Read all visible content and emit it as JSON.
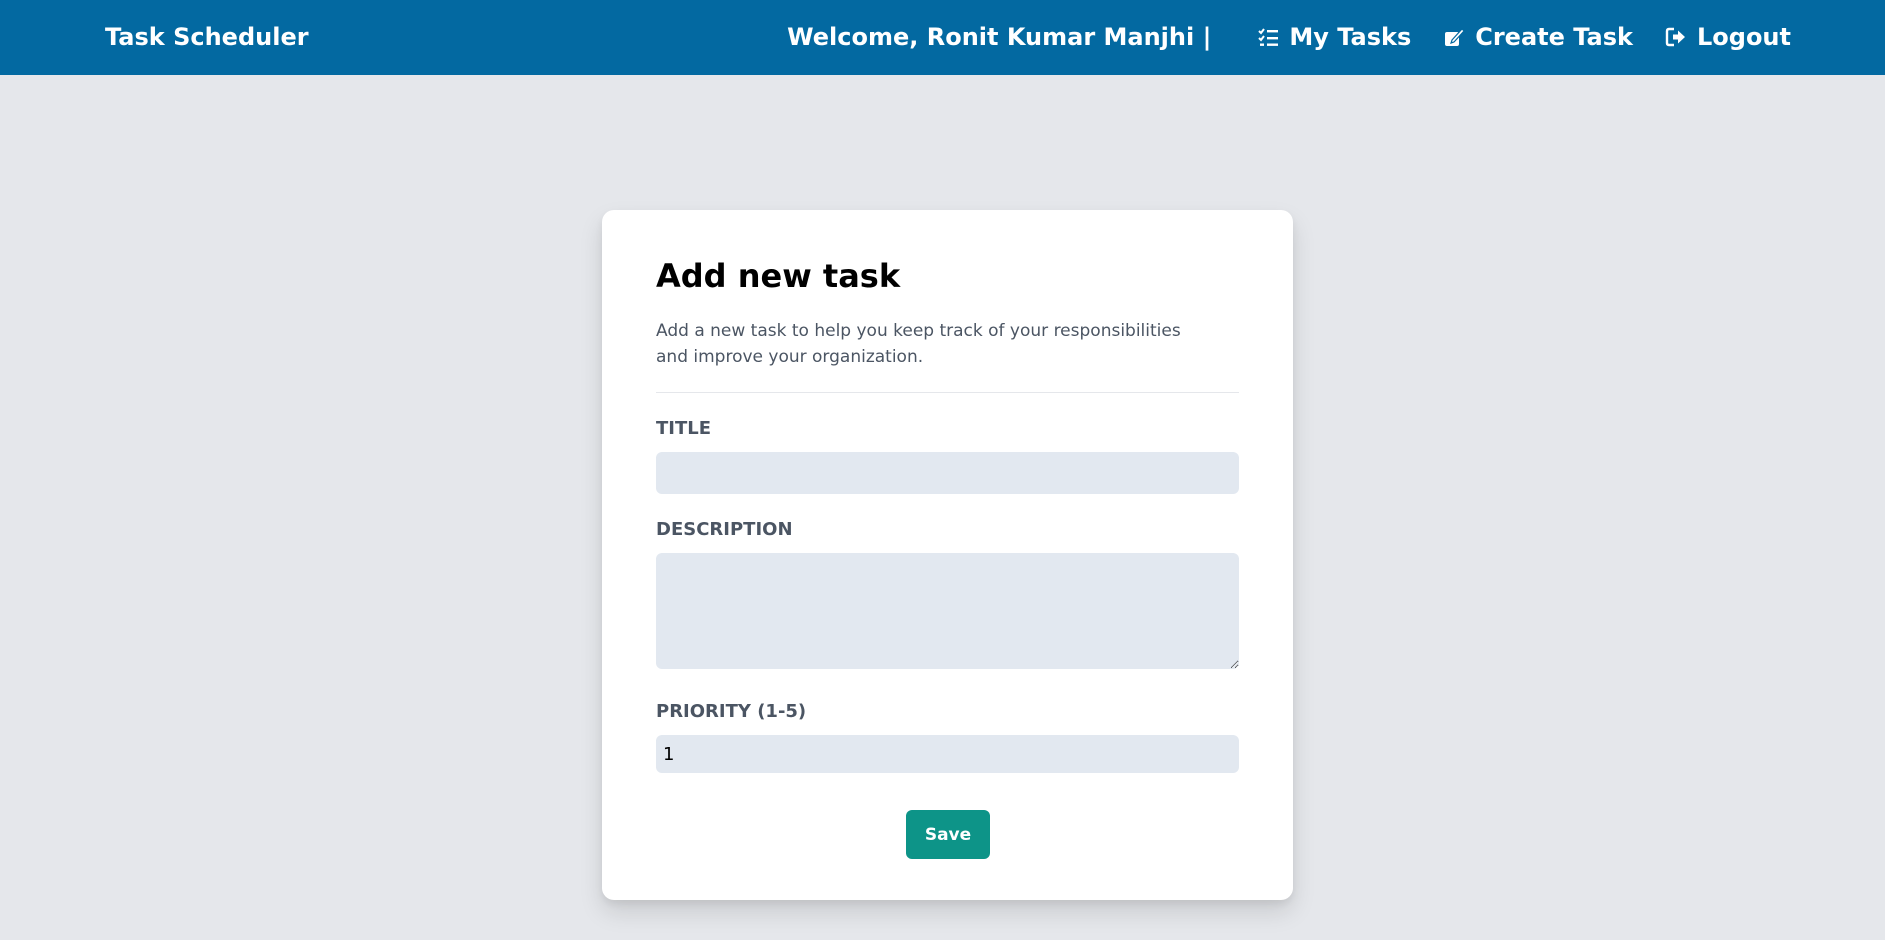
{
  "navbar": {
    "brand": "Task Scheduler",
    "welcome": "Welcome, Ronit Kumar Manjhi |",
    "links": [
      {
        "label": "My Tasks",
        "icon": "task-list-icon"
      },
      {
        "label": "Create Task",
        "icon": "edit-icon"
      },
      {
        "label": "Logout",
        "icon": "logout-icon"
      }
    ],
    "color": "#0369a1"
  },
  "form": {
    "title": "Add new task",
    "description": "Add a new task to help you keep track of your responsibilities and improve your organization.",
    "fields": {
      "title": {
        "label": "TITLE",
        "value": ""
      },
      "description": {
        "label": "DESCRIPTION",
        "value": ""
      },
      "priority": {
        "label": "PRIORITY (1-5)",
        "value": "1"
      }
    },
    "save_label": "Save",
    "save_color": "#0d9488"
  }
}
